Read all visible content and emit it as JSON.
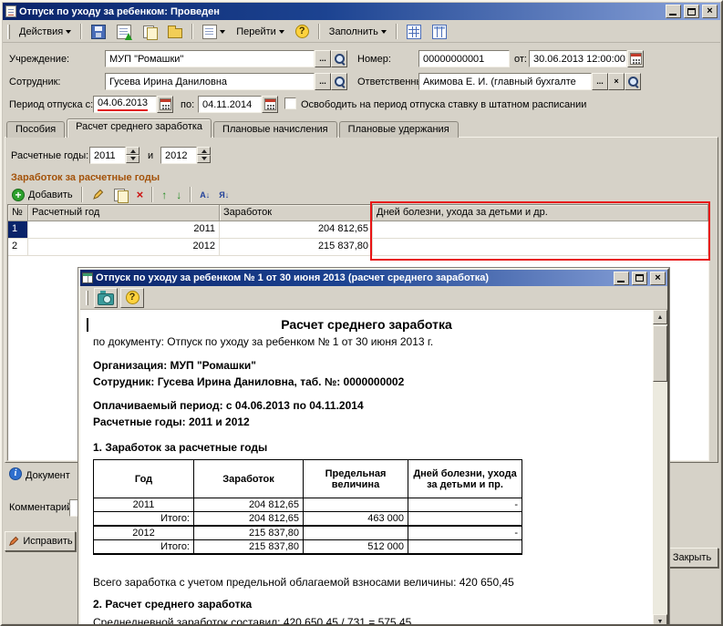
{
  "window": {
    "title": "Отпуск по уходу за ребенком: Проведен"
  },
  "icons": {
    "help": "?",
    "close": "×",
    "dots": "...",
    "clear": "×",
    "delete": "×",
    "move_up": "↑",
    "move_down": "↓",
    "scroll_up": "▲",
    "scroll_down": "▼"
  },
  "toolbar": {
    "actions_label": "Действия",
    "goto_label": "Перейти",
    "fill_label": "Заполнить"
  },
  "form": {
    "institution": {
      "label": "Учреждение:",
      "value": "МУП \"Ромашки\""
    },
    "employee": {
      "label": "Сотрудник:",
      "value": "Гусева Ирина Даниловна"
    },
    "number": {
      "label": "Номер:",
      "value": "00000000001"
    },
    "doc_date": {
      "label": "от:",
      "value": "30.06.2013 12:00:00"
    },
    "responsible": {
      "label": "Ответственный:",
      "value": "Акимова Е. И. (главный бухгалте"
    },
    "period": {
      "label": "Период отпуска с:",
      "from": "04.06.2013",
      "to_label": "по:",
      "to": "04.11.2014"
    },
    "release_checkbox": "Освободить на период отпуска ставку в штатном расписании"
  },
  "tabs": [
    "Пособия",
    "Расчет среднего заработка",
    "Плановые начисления",
    "Плановые удержания"
  ],
  "calc_tab": {
    "years_label": "Расчетные годы:",
    "year1": "2011",
    "conj": "и",
    "year2": "2012",
    "section_header": "Заработок за расчетные годы",
    "add_button": "Добавить",
    "sort_asc": "А↓",
    "sort_desc": "Я↓",
    "table": {
      "columns": [
        "№",
        "Расчетный год",
        "Заработок",
        "Дней болезни, ухода за детьми и др."
      ],
      "rows": [
        [
          "1",
          "2011",
          "204 812,65",
          ""
        ],
        [
          "2",
          "2012",
          "215 837,80",
          ""
        ]
      ]
    }
  },
  "footer": {
    "info": "Документ",
    "comment_label": "Комментарий",
    "fix_button": "Исправить",
    "close_button": "Закрыть"
  },
  "report": {
    "title": "Отпуск по уходу за ребенком № 1 от 30 июня 2013 (расчет среднего заработка)",
    "doc": {
      "heading": "Расчет среднего заработка",
      "subheading": "по документу: Отпуск по уходу за ребенком № 1 от 30 июня 2013 г.",
      "organization": "Организация: МУП \"Ромашки\"",
      "employee": "Сотрудник: Гусева Ирина Даниловна, таб. №: 0000000002",
      "period": "Оплачиваемый период: с 04.06.2013 по 04.11.2014",
      "years": "Расчетные годы: 2011 и 2012",
      "section1": "1. Заработок за расчетные годы",
      "table": {
        "columns": [
          "Год",
          "Заработок",
          "Предельная величина",
          "Дней болезни, ухода за детьми и пр."
        ],
        "rows": [
          [
            "2011",
            "204 812,65",
            "",
            "-"
          ],
          [
            "Итого:",
            "204 812,65",
            "463 000",
            ""
          ],
          [
            "2012",
            "215 837,80",
            "",
            "-"
          ],
          [
            "Итого:",
            "215 837,80",
            "512 000",
            ""
          ]
        ]
      },
      "total_line": "Всего заработка с учетом предельной облагаемой взносами величины: 420 650,45",
      "section2": "2. Расчет среднего заработка",
      "avg_prefix": "Среднедневной заработок составил: ",
      "avg_formula": "420 650,45 / 731 = 575,45"
    }
  }
}
